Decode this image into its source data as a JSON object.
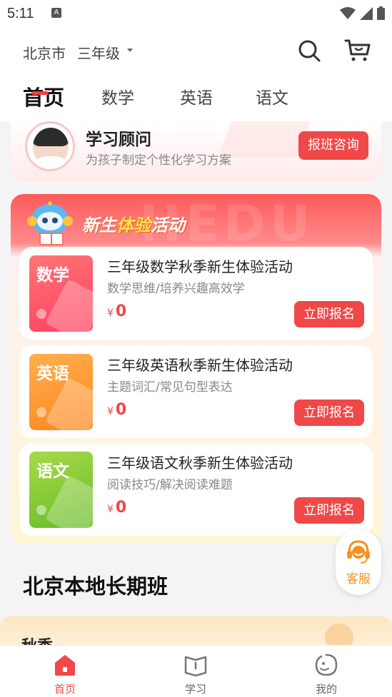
{
  "status_bar": {
    "time": "5:11",
    "notif_icon_letter": "A"
  },
  "header": {
    "city": "北京市",
    "grade": "三年级",
    "tabs": [
      {
        "label": "首页",
        "active": true
      },
      {
        "label": "数学",
        "active": false
      },
      {
        "label": "英语",
        "active": false
      },
      {
        "label": "语文",
        "active": false
      }
    ]
  },
  "advisor": {
    "title": "学习顾问",
    "subtitle": "为孩子制定个性化学习方案",
    "button": "报班咨询"
  },
  "promo": {
    "title_part1": "新生",
    "title_part2": "体验",
    "title_part3": "活动",
    "courses": [
      {
        "thumb_label": "数学",
        "title": "三年级数学秋季新生体验活动",
        "subtitle": "数学思维/培养兴趣高效学",
        "currency": "¥",
        "price": "0",
        "button": "立即报名",
        "color_top": "#ff6b6b",
        "color_bottom": "#ff3e5e"
      },
      {
        "thumb_label": "英语",
        "title": "三年级英语秋季新生体验活动",
        "subtitle": "主题词汇/常见句型表达",
        "currency": "¥",
        "price": "0",
        "button": "立即报名",
        "color_top": "#ffa54a",
        "color_bottom": "#ff8a1e"
      },
      {
        "thumb_label": "语文",
        "title": "三年级语文秋季新生体验活动",
        "subtitle": "阅读技巧/解决阅读难题",
        "currency": "¥",
        "price": "0",
        "button": "立即报名",
        "color_top": "#a6d94a",
        "color_bottom": "#6bbf2a"
      }
    ]
  },
  "service": {
    "label": "客服"
  },
  "local": {
    "section_title": "北京本地长期班",
    "card_title": "秋季"
  },
  "bottom_nav": [
    {
      "label": "首页",
      "active": true,
      "icon": "home-icon"
    },
    {
      "label": "学习",
      "active": false,
      "icon": "book-icon"
    },
    {
      "label": "我的",
      "active": false,
      "icon": "profile-icon"
    }
  ],
  "colors": {
    "accent": "#f04848",
    "service": "#f5921e"
  }
}
